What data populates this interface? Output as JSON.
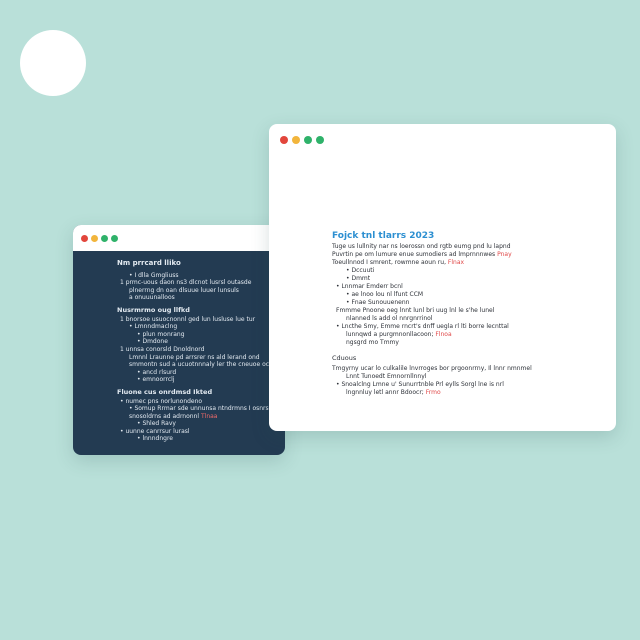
{
  "colors": {
    "background": "#b9e0d9",
    "dark_window": "#233b52",
    "accent_blue": "#2c8fd1",
    "note_red": "#e04848",
    "dot_red": "#e2463c",
    "dot_yellow": "#f2b53c",
    "dot_green": "#2fb26a"
  },
  "dark_window": {
    "heading": "Nm prrcard lliko",
    "lines": [
      {
        "text": "• I dlla Gmgliuss",
        "level": 2
      },
      {
        "text": "1 prmc-uous daon ns3 dlcnot lusrsl outasde",
        "level": 1
      },
      {
        "text": "plnerrng dn oan dlsuue luuer lunsuls",
        "level": 2
      },
      {
        "text": "a onuuunalloos",
        "level": 2
      }
    ],
    "section2_heading": "Nusrmrmo oug llfkd",
    "section2_lines": [
      {
        "text": "1 bnorsoe usuocnonnl ged lun lusluse lue tur",
        "level": 1
      },
      {
        "text": "• Lmnndmaclng",
        "level": 2
      },
      {
        "text": "• plun monrang",
        "level": 3
      },
      {
        "text": "• Dmdone",
        "level": 3
      },
      {
        "text": "1 unnsa conorsld Dnoldnord",
        "level": 1
      },
      {
        "text": "Lmnnl Lraunne pd arrsrer ns ald lerand ond",
        "level": 2
      },
      {
        "text": "smmontn sud a ucuotnnnaly ler the cneuoe ocruc",
        "level": 2
      },
      {
        "text": "• ancd rlsurd",
        "level": 3
      },
      {
        "text": "• emnoorrclj",
        "level": 3
      }
    ],
    "section3_heading": "Fluone cus onrdmsd Ikted",
    "section3_lines": [
      {
        "text": "• numec pns norlunondeno",
        "level": 1
      },
      {
        "text": "• Somup Rrmar sde unnunsa ntndrmns I osnrs uulur",
        "level": 2
      },
      {
        "text": "snosoldrns ad adrnonnl",
        "level": 2,
        "note": "Tlnaa"
      },
      {
        "text": "• Shled Ravy",
        "level": 3
      },
      {
        "text": "• uunne canrrsur lurasl",
        "level": 1
      },
      {
        "text": "• lnnndngre",
        "level": 3
      }
    ]
  },
  "light_window": {
    "title": "Fojck tnl tlarrs 2023",
    "paragraph": [
      {
        "text": "Tuge us lullnity nar ns loerossn ond rgtb eumg pnd lu lapnd"
      },
      {
        "text": "Puvrtin pe om lumure enue sumodiers ad lmprnnnwes",
        "note": "Pnay"
      },
      {
        "text": "Toeullnnod I smrent, rowmne aoun ru,",
        "note": "Flnax"
      }
    ],
    "bullets": [
      {
        "text": "• Dccuuti",
        "level": 2
      },
      {
        "text": "• Dmmt",
        "level": 2
      },
      {
        "text": "• Lnnmar Emderr bcnl",
        "level": 1
      },
      {
        "text": "• ae lnoo lou nl lfunt CCM",
        "level": 2
      },
      {
        "text": "• Fnae Sunouuenenn",
        "level": 2
      },
      {
        "text": "Fmmme Pnoone oeg lnnt lunl bri uug lnl le s'he lunel",
        "level": 1
      },
      {
        "text": "nlanned ls add ol nnrgnrrinol",
        "level": 2
      },
      {
        "text": "• Lncthe Smy, Emme rncrt's dnff uegla rl lti borre lecnttal",
        "level": 1
      },
      {
        "text": "lunnqwd a purgmnonllacoon;",
        "level": 2,
        "note": "Flnoa"
      },
      {
        "text": "ngsgrd mo Tmmy",
        "level": 2
      }
    ],
    "sub_heading": "Cduous",
    "sub_paragraph": [
      {
        "text": "Tmgyrny ucar lo culkalile lnvrroges bor prgoonrrny, Il lnnr nmnmel"
      },
      {
        "text": "Lnnt Tunoedt Emnornllnnyl",
        "level": 2
      },
      {
        "text": "• Snoalclng Lmne u' Sunurrtnble Prl eylls Sorgl lne is nrl",
        "level": 1
      },
      {
        "text": "lngnnluy letl annr Bdoocr;",
        "level": 2,
        "note": "Frmo"
      }
    ]
  }
}
